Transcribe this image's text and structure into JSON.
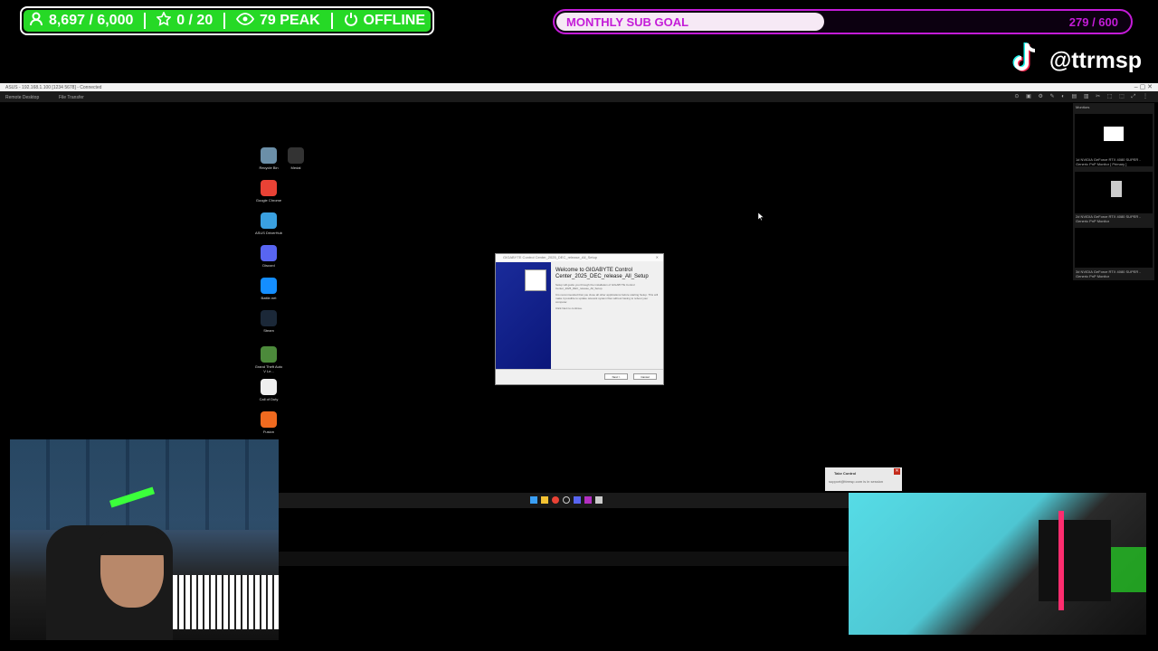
{
  "stats": {
    "followers": "8,697 / 6,000",
    "stars": "0 / 20",
    "peak": "79 PEAK",
    "status": "OFFLINE",
    "color": "#26d926"
  },
  "sub_goal": {
    "label": "MONTHLY SUB GOAL",
    "count": "279 / 600",
    "progress": 0.465,
    "color": "#c41bd8"
  },
  "social": {
    "handle": "@ttrmsp",
    "icon": "tiktok-icon"
  },
  "remote": {
    "window_title": "ASUS - 192.168.1.100 [1234 5678] - Connected",
    "tab_desktop": "Remote Desktop",
    "tab_file": "File Transfer"
  },
  "desktop_icons": [
    {
      "label": "Recycle Bin",
      "color": "#6b8fa8"
    },
    {
      "label": "Medal",
      "color": "#333"
    },
    {
      "label": "Google Chrome",
      "color": "#e94235"
    },
    {
      "label": "ASUS DriverHub",
      "color": "#3aa0e0"
    },
    {
      "label": "Discord",
      "color": "#5865f2"
    },
    {
      "label": "Battle.net",
      "color": "#148eff"
    },
    {
      "label": "Steam",
      "color": "#1b2838"
    },
    {
      "label": "Grand Theft Auto V Le...",
      "color": "#4c8a3b"
    },
    {
      "label": "Call of Duty",
      "color": "#eeeeee"
    },
    {
      "label": "Fusion",
      "color": "#f06a1f"
    }
  ],
  "installer": {
    "title": "GIGABYTE Control Center_2025_DEC_release_All_Setup",
    "heading": "Welcome to GIGABYTE Control Center_2025_DEC_release_All_Setup",
    "body1": "Setup will guide you through the installation of GIGABYTE Control Center_2025_DEC_release_All_Setup.",
    "body2": "It is recommended that you close all other applications before starting Setup. This will make it possible to update relevant system files without having to reboot your computer.",
    "body3": "Click Next to continue.",
    "next": "Next >",
    "cancel": "Cancel"
  },
  "monitors": {
    "title": "Monitors",
    "items": [
      "1# NVIDIA GeForce RTX 4080 SUPER - Generic PnP Monitor [ Primary ]",
      "2# NVIDIA GeForce RTX 4080 SUPER - Generic PnP Monitor",
      "3# NVIDIA GeForce RTX 4080 SUPER - Generic PnP Monitor"
    ]
  },
  "toast": {
    "title": "Take Control",
    "text": "support@ttrmsp.com is in session"
  }
}
